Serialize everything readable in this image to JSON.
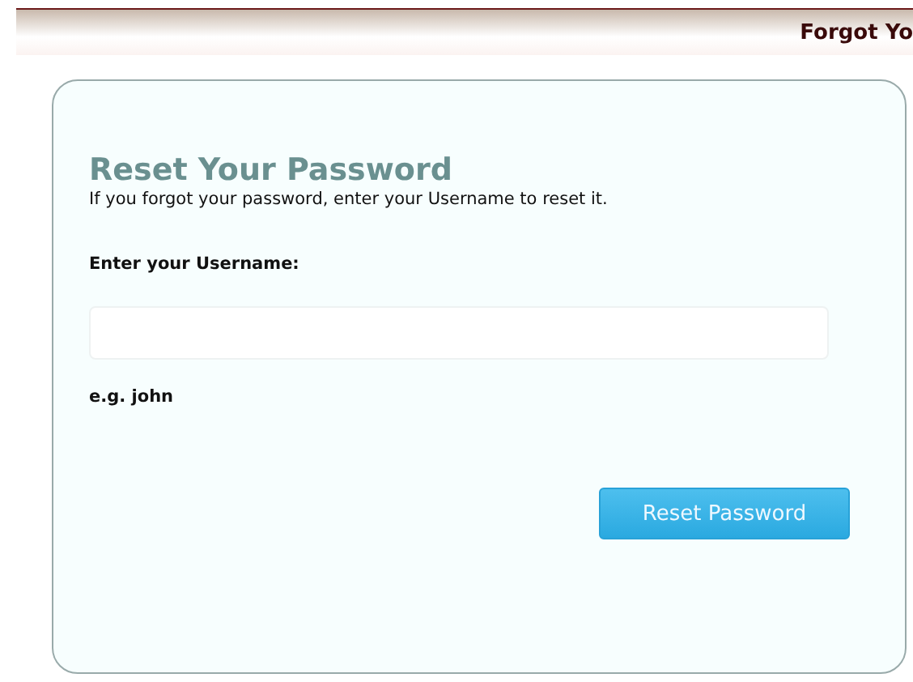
{
  "header": {
    "title": "Forgot Yo"
  },
  "form": {
    "heading": "Reset Your Password",
    "description": "If you forgot your password, enter your Username to reset it.",
    "field_label": "Enter your Username:",
    "hint": "e.g. john",
    "button": "Reset Password"
  }
}
